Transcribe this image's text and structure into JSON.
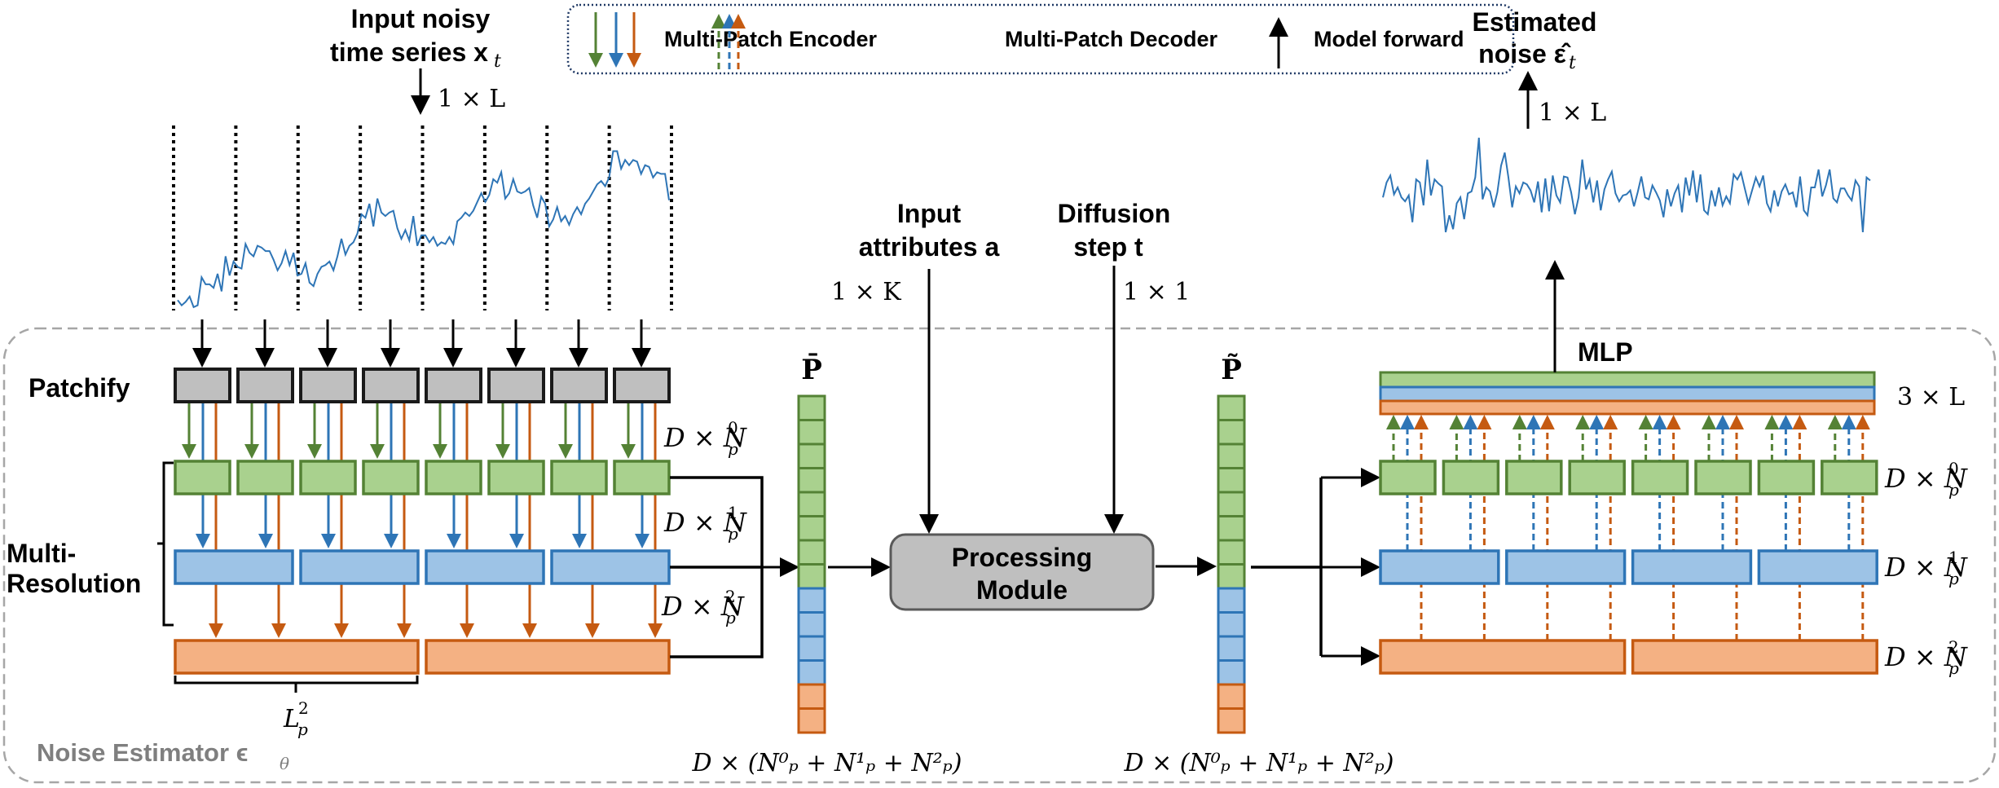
{
  "colors": {
    "green_stroke": "#548235",
    "green_fill": "#a9d18e",
    "blue_stroke": "#2e75b6",
    "blue_fill": "#9dc3e6",
    "orange_stroke": "#c55a11",
    "orange_fill": "#f4b183",
    "gray_fill": "#bfbfbf",
    "series_line": "#2e75b6",
    "legend_border": "#1f3864",
    "outer_border": "#a6a6a6",
    "noise_estimator_text": "#7f7f7f"
  },
  "legend": {
    "encoder_label": "Multi-Patch Encoder",
    "decoder_label": "Multi-Patch Decoder",
    "forward_label": "Model forward"
  },
  "input": {
    "title_line1": "Input noisy",
    "title_line2": "time series x",
    "title_sub": "t",
    "shape": "1 × L",
    "patch_count": 8
  },
  "output": {
    "title_line1": "Estimated",
    "title_line2": "noise ε̂",
    "title_sub": "t",
    "shape": "1 × L"
  },
  "encoder": {
    "patchify_label": "Patchify",
    "multires_line1": "Multi-",
    "multires_line2": "Resolution",
    "level0_count": 8,
    "level1_count": 4,
    "level2_count": 2,
    "level0_shape": "D × N",
    "level0_sup": "0",
    "level1_shape": "D × N",
    "level1_sup": "1",
    "level2_shape": "D × N",
    "level2_sup": "2",
    "shape_sub": "p",
    "patch_len_label": "L",
    "patch_len_sup": "2",
    "patch_len_sub": "p"
  },
  "p_bar": {
    "label": "P̄",
    "green_cells": 8,
    "blue_cells": 4,
    "orange_cells": 2,
    "shape": "D × (N⁰ₚ + N¹ₚ + N²ₚ)"
  },
  "p_tilde": {
    "label": "P̃",
    "green_cells": 8,
    "blue_cells": 4,
    "orange_cells": 2,
    "shape": "D × (N⁰ₚ + N¹ₚ + N²ₚ)"
  },
  "processing": {
    "line1": "Processing",
    "line2": "Module"
  },
  "attributes": {
    "line1": "Input",
    "line2": "attributes a",
    "shape": "1 × K"
  },
  "diffusion": {
    "line1": "Diffusion",
    "line2": "step t",
    "shape": "1 × 1"
  },
  "decoder": {
    "mlp_label": "MLP",
    "mlp_shape": "3 × L",
    "level0_count": 8,
    "level1_count": 4,
    "level2_count": 2
  },
  "container": {
    "label": "Noise Estimator ϵ",
    "label_sub": "θ"
  },
  "series": {
    "input_noisy": [
      0.05,
      0.02,
      0.04,
      0.07,
      0.01,
      0.02,
      0.18,
      0.14,
      0.14,
      0.12,
      0.2,
      0.1,
      0.3,
      0.19,
      0.27,
      0.24,
      0.23,
      0.37,
      0.32,
      0.3,
      0.36,
      0.35,
      0.33,
      0.33,
      0.28,
      0.22,
      0.26,
      0.33,
      0.25,
      0.32,
      0.19,
      0.2,
      0.26,
      0.15,
      0.13,
      0.2,
      0.24,
      0.25,
      0.27,
      0.22,
      0.3,
      0.4,
      0.31,
      0.36,
      0.38,
      0.43,
      0.54,
      0.52,
      0.6,
      0.47,
      0.63,
      0.55,
      0.53,
      0.55,
      0.56,
      0.46,
      0.4,
      0.45,
      0.39,
      0.53,
      0.36,
      0.42,
      0.42,
      0.38,
      0.41,
      0.36,
      0.38,
      0.37,
      0.41,
      0.37,
      0.5,
      0.52,
      0.55,
      0.53,
      0.56,
      0.61,
      0.66,
      0.61,
      0.65,
      0.74,
      0.72,
      0.78,
      0.63,
      0.66,
      0.74,
      0.67,
      0.66,
      0.67,
      0.69,
      0.59,
      0.52,
      0.64,
      0.6,
      0.47,
      0.51,
      0.58,
      0.5,
      0.53,
      0.48,
      0.54,
      0.58,
      0.54,
      0.6,
      0.63,
      0.67,
      0.71,
      0.73,
      0.7,
      0.75,
      0.9,
      0.9,
      0.8,
      0.85,
      0.82,
      0.85,
      0.84,
      0.77,
      0.82,
      0.81,
      0.75,
      0.78,
      0.77,
      0.77,
      0.62
    ],
    "estimated_noise": [
      0.4,
      0.55,
      0.62,
      0.43,
      0.5,
      0.4,
      0.36,
      0.42,
      0.15,
      0.58,
      0.55,
      0.32,
      0.78,
      0.42,
      0.58,
      0.54,
      0.51,
      0.05,
      0.22,
      0.08,
      0.34,
      0.4,
      0.18,
      0.44,
      0.46,
      0.6,
      1.0,
      0.38,
      0.5,
      0.46,
      0.3,
      0.45,
      0.72,
      0.85,
      0.6,
      0.3,
      0.51,
      0.44,
      0.55,
      0.53,
      0.47,
      0.35,
      0.56,
      0.25,
      0.59,
      0.26,
      0.62,
      0.42,
      0.35,
      0.61,
      0.6,
      0.45,
      0.23,
      0.4,
      0.78,
      0.48,
      0.58,
      0.35,
      0.57,
      0.27,
      0.48,
      0.58,
      0.66,
      0.44,
      0.36,
      0.42,
      0.43,
      0.47,
      0.31,
      0.45,
      0.61,
      0.4,
      0.38,
      0.52,
      0.45,
      0.37,
      0.2,
      0.48,
      0.31,
      0.44,
      0.52,
      0.25,
      0.6,
      0.42,
      0.67,
      0.35,
      0.63,
      0.27,
      0.23,
      0.47,
      0.31,
      0.5,
      0.32,
      0.41,
      0.34,
      0.63,
      0.58,
      0.65,
      0.49,
      0.34,
      0.47,
      0.6,
      0.51,
      0.62,
      0.34,
      0.26,
      0.47,
      0.31,
      0.46,
      0.53,
      0.43,
      0.45,
      0.3,
      0.61,
      0.27,
      0.22,
      0.5,
      0.5,
      0.68,
      0.41,
      0.52,
      0.68,
      0.39,
      0.35,
      0.49,
      0.49,
      0.42,
      0.37,
      0.57,
      0.51,
      0.05,
      0.6,
      0.57
    ]
  }
}
